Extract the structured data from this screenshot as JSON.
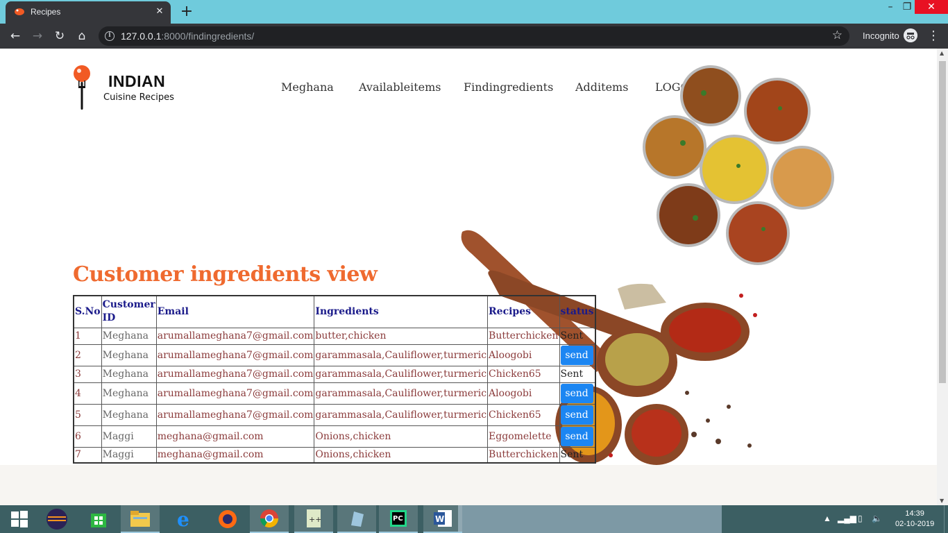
{
  "browser": {
    "tab_title": "Recipes",
    "url_host": "127.0.0.1",
    "url_path": ":8000/findingredients/",
    "profile_label": "Incognito"
  },
  "brand": {
    "title": "INDIAN",
    "subtitle": "Cuisine Recipes"
  },
  "nav": {
    "items": [
      "Meghana",
      "Availableitems",
      "Findingredients",
      "Additems",
      "LOGOUT"
    ]
  },
  "page": {
    "heading": "Customer ingredients view"
  },
  "table": {
    "headers": [
      "S.No",
      "Customer ID",
      "Email",
      "Ingredients",
      "Recipes",
      "status"
    ],
    "rows": [
      {
        "sno": "1",
        "customer": "Meghana",
        "email": "arumallameghana7@gmail.com",
        "ingredients": "butter,chicken",
        "recipe": "Butterchicken",
        "status": "Sent"
      },
      {
        "sno": "2",
        "customer": "Meghana",
        "email": "arumallameghana7@gmail.com",
        "ingredients": "garammasala,Cauliflower,turmeric",
        "recipe": "Aloogobi",
        "status": "send"
      },
      {
        "sno": "3",
        "customer": "Meghana",
        "email": "arumallameghana7@gmail.com",
        "ingredients": "garammasala,Cauliflower,turmeric",
        "recipe": "Chicken65",
        "status": "Sent"
      },
      {
        "sno": "4",
        "customer": "Meghana",
        "email": "arumallameghana7@gmail.com",
        "ingredients": "garammasala,Cauliflower,turmeric",
        "recipe": "Aloogobi",
        "status": "send"
      },
      {
        "sno": "5",
        "customer": "Meghana",
        "email": "arumallameghana7@gmail.com",
        "ingredients": "garammasala,Cauliflower,turmeric",
        "recipe": "Chicken65",
        "status": "send"
      },
      {
        "sno": "6",
        "customer": "Maggi",
        "email": "meghana@gmail.com",
        "ingredients": "Onions,chicken",
        "recipe": "Eggomelette",
        "status": "send"
      },
      {
        "sno": "7",
        "customer": "Maggi",
        "email": "meghana@gmail.com",
        "ingredients": "Onions,chicken",
        "recipe": "Butterchicken",
        "status": "Sent"
      }
    ]
  },
  "taskbar": {
    "time": "14:39",
    "date": "02-10-2019"
  },
  "colors": {
    "accent": "#ef6a2f",
    "button": "#1c86f2",
    "header_text": "#1a1a8a",
    "cell_text": "#8a3a3a"
  }
}
